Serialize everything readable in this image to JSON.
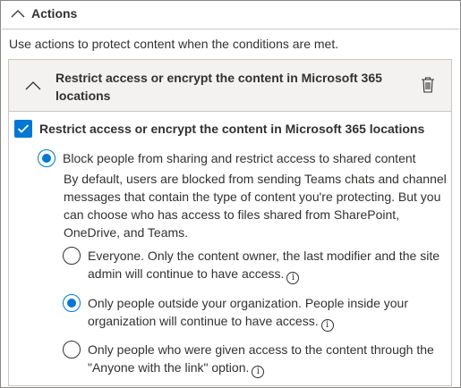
{
  "section": {
    "title": "Actions",
    "description": "Use actions to protect content when the conditions are met."
  },
  "rule": {
    "title": "Restrict access or encrypt the content in Microsoft 365 locations",
    "checkbox_label": "Restrict access or encrypt the content in Microsoft 365 locations",
    "checkbox_checked": true,
    "main_option": {
      "label": "Block people from sharing and restrict access to shared content",
      "selected": true,
      "description": "By default, users are blocked from sending Teams chats and channel messages that contain the type of content you're protecting. But you can choose who has access to files shared from SharePoint, OneDrive, and Teams."
    },
    "sub_options": [
      {
        "label": "Everyone. Only the content owner, the last modifier and the site admin will continue to have access.",
        "selected": false
      },
      {
        "label": "Only people outside your organization. People inside your organization will continue to have access.",
        "selected": true
      },
      {
        "label": "Only people who were given access to the content through the \"Anyone with the link\" option.",
        "selected": false
      }
    ]
  },
  "icons": {
    "collapse": "chevron-up-icon",
    "delete": "trash-icon",
    "info": "info-icon",
    "check": "checkmark-icon"
  },
  "colors": {
    "accent": "#0078d4",
    "header_bg": "#f3f2f1",
    "border": "#c8c6c4",
    "text": "#323130"
  }
}
